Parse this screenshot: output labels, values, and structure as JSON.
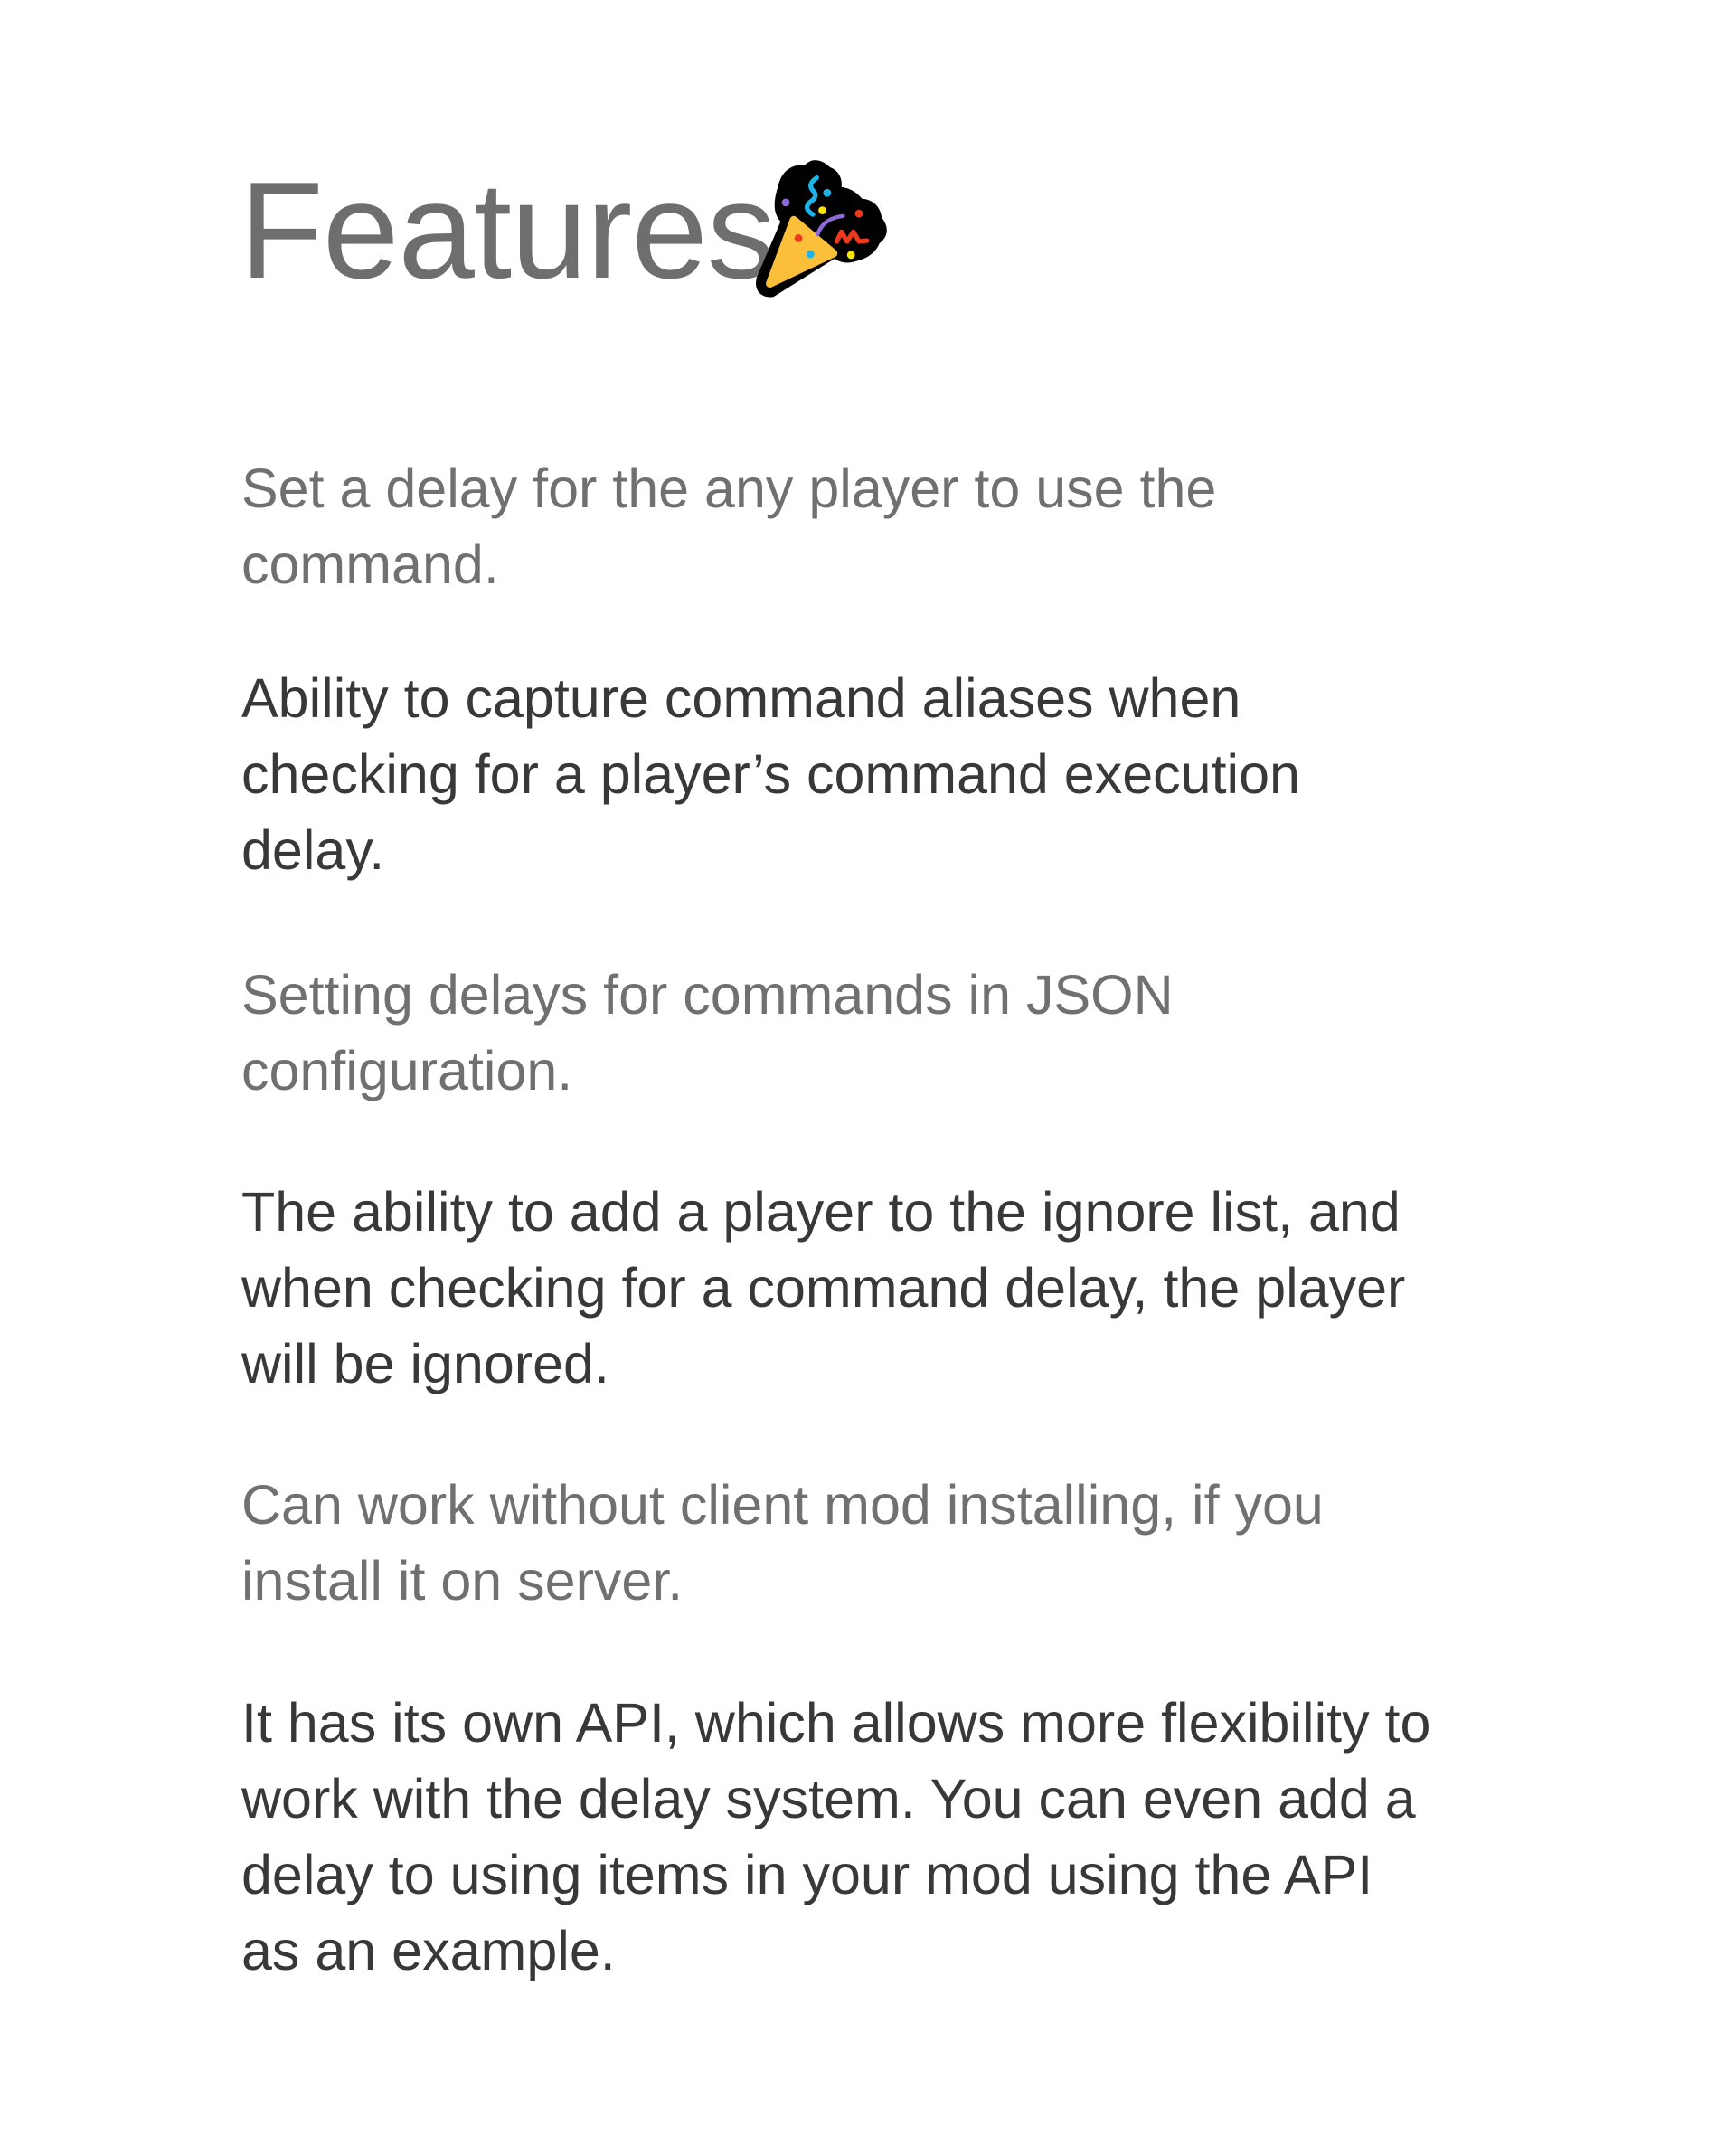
{
  "title": "Features",
  "title_icon": "party-popper-icon",
  "colors": {
    "muted_text": "#707070",
    "dark_text": "#383838",
    "title_text": "#6e6e6e"
  },
  "features": [
    {
      "lines": [
        "Set a delay for the any player to use the",
        "command."
      ]
    },
    {
      "lines": [
        "Ability to capture command aliases when",
        "checking for a player’s command execution",
        "delay."
      ]
    },
    {
      "lines": [
        "Setting delays for commands in JSON",
        "configuration."
      ]
    },
    {
      "lines": [
        "The ability to add a player to the ignore list, and",
        "when checking for a command delay, the player",
        "will be ignored."
      ]
    },
    {
      "lines": [
        "Can work without client mod installing, if you",
        "install it on server."
      ]
    },
    {
      "lines": [
        "It has its own API, which allows more flexibility to",
        "work with the delay system. You can even add a",
        "delay to using items in your mod using the API",
        "as an example."
      ]
    }
  ]
}
